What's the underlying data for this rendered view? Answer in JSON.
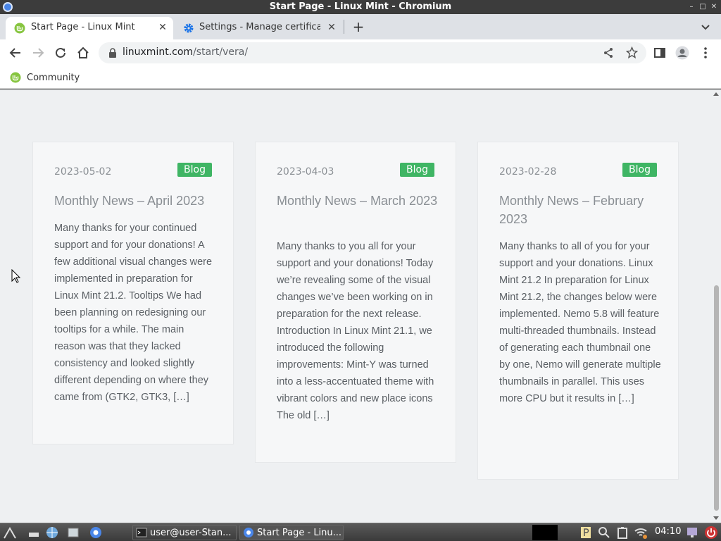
{
  "window": {
    "title": "Start Page - Linux Mint - Chromium"
  },
  "tabs": [
    {
      "label": "Start Page - Linux Mint",
      "active": true,
      "icon": "linux-mint-icon"
    },
    {
      "label": "Settings - Manage certifica",
      "active": false,
      "icon": "gear-icon"
    }
  ],
  "toolbar": {
    "url_host": "linuxmint.com",
    "url_path": "/start/vera/"
  },
  "bookmarks": [
    {
      "label": "Community",
      "icon": "linux-mint-icon"
    }
  ],
  "posts": [
    {
      "date": "2023-05-02",
      "badge": "Blog",
      "title": "Monthly News – April 2023",
      "excerpt": "Many thanks for your continued support and for your donations! A few additional visual changes were implemented in preparation for Linux Mint 21.2. Tooltips We had been planning on redesigning our tooltips for a while. The main reason was that they lacked consistency and looked slightly different depending on where they came from (GTK2, GTK3, […]"
    },
    {
      "date": "2023-04-03",
      "badge": "Blog",
      "title": "Monthly News – March 2023",
      "excerpt": "Many thanks to you all for your support and your donations! Today we’re revealing some of the visual changes we’ve been working on in preparation for the next release. Introduction In Linux Mint 21.1, we introduced the following improvements: Mint-Y was turned into a less-accentuated theme with vibrant colors and new place icons The old […]"
    },
    {
      "date": "2023-02-28",
      "badge": "Blog",
      "title": "Monthly News – February 2023",
      "excerpt": "Many thanks to all of you for your support and your donations. Linux Mint 21.2 In preparation for Linux Mint 21.2, the changes below were implemented. Nemo 5.8 will feature multi-threaded thumbnails. Instead of generating each thumbnail one by one, Nemo will generate multiple thumbnails in parallel. This uses more CPU but it results in […]"
    }
  ],
  "taskbar": {
    "tasks": [
      {
        "label": "user@user-Stan...",
        "icon": "terminal-icon"
      },
      {
        "label": "Start Page - Linu...",
        "icon": "chromium-icon"
      }
    ],
    "clock": "04:10"
  },
  "colors": {
    "badge": "#3fb564",
    "page_bg": "#eef0f2",
    "tab_strip": "#dee1e6"
  }
}
